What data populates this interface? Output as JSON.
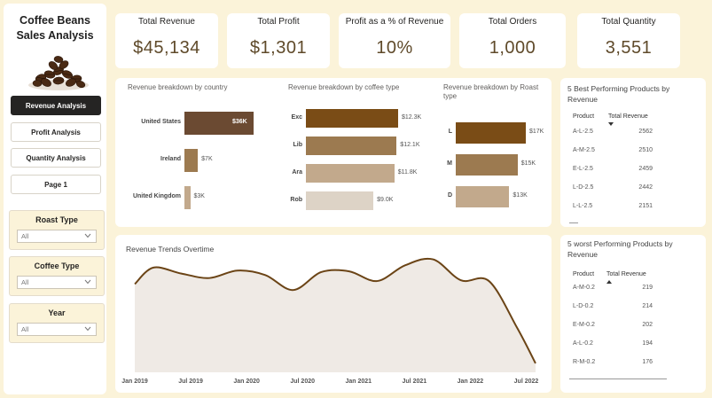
{
  "app": {
    "title_line1": "Coffee Beans",
    "title_line2": "Sales Analysis",
    "image_icon": "coffee-beans-image"
  },
  "nav": [
    {
      "label": "Revenue Analysis",
      "active": true
    },
    {
      "label": "Profit Analysis",
      "active": false
    },
    {
      "label": "Quantity Analysis",
      "active": false
    },
    {
      "label": "Page 1",
      "active": false
    }
  ],
  "filters": [
    {
      "title": "Roast Type",
      "value": "All"
    },
    {
      "title": "Coffee Type",
      "value": "All"
    },
    {
      "title": "Year",
      "value": "All"
    }
  ],
  "kpis": [
    {
      "title": "Total Revenue",
      "value": "$45,134"
    },
    {
      "title": "Total Profit",
      "value": "$1,301"
    },
    {
      "title": "Profit as a % of Revenue",
      "value": "10%"
    },
    {
      "title": "Total Orders",
      "value": "1,000"
    },
    {
      "title": "Total Quantity",
      "value": "3,551"
    }
  ],
  "colors": {
    "dark_brown": "#7a4c16",
    "mid_brown": "#9c7a50",
    "light_brown": "#c2a98c",
    "pale_brown": "#ddd3c6",
    "country_dark": "#6b4a32",
    "line": "#6b4416",
    "area": "#efeae5",
    "page_bg": "#fbf3d9",
    "nav_active": "#252423"
  },
  "chart_data": [
    {
      "type": "bar",
      "orientation": "horizontal",
      "title": "Revenue breakdown by country",
      "categories": [
        "United States",
        "Ireland",
        "United Kingdom"
      ],
      "values": [
        36000,
        7000,
        3000
      ],
      "labels": [
        "$36K",
        "$7K",
        "$3K"
      ]
    },
    {
      "type": "bar",
      "orientation": "horizontal",
      "title": "Revenue breakdown by coffee type",
      "categories": [
        "Exc",
        "Lib",
        "Ara",
        "Rob"
      ],
      "values": [
        12300,
        12100,
        11800,
        9000
      ],
      "labels": [
        "$12.3K",
        "$12.1K",
        "$11.8K",
        "$9.0K"
      ]
    },
    {
      "type": "bar",
      "orientation": "horizontal",
      "title": "Revenue breakdown by Roast type",
      "categories": [
        "L",
        "M",
        "D"
      ],
      "values": [
        17000,
        15000,
        13000
      ],
      "labels": [
        "$17K",
        "$15K",
        "$13K"
      ]
    },
    {
      "type": "area",
      "title": "Revenue Trends Overtime",
      "x_tick_labels": [
        "Jan 2019",
        "Jul 2019",
        "Jan 2020",
        "Jul 2020",
        "Jan 2021",
        "Jul 2021",
        "Jan 2022",
        "Jul 2022"
      ],
      "x": [
        "2019-01",
        "2019-03",
        "2019-06",
        "2019-09",
        "2019-12",
        "2020-03",
        "2020-06",
        "2020-09",
        "2020-12",
        "2021-03",
        "2021-06",
        "2021-09",
        "2021-12",
        "2022-03",
        "2022-06",
        "2022-08"
      ],
      "y": [
        1180,
        1400,
        1320,
        1260,
        1360,
        1300,
        1100,
        1340,
        1350,
        1220,
        1430,
        1510,
        1230,
        1220,
        600,
        120
      ],
      "y_range": [
        0,
        1600
      ]
    }
  ],
  "best_products": {
    "title": "5 Best Performing Products by Revenue",
    "col_product": "Product",
    "col_revenue": "Total Revenue",
    "rows": [
      {
        "product": "A-L-2.5",
        "revenue": "2562"
      },
      {
        "product": "A-M-2.5",
        "revenue": "2510"
      },
      {
        "product": "E-L-2.5",
        "revenue": "2459"
      },
      {
        "product": "L-D-2.5",
        "revenue": "2442"
      },
      {
        "product": "L-L-2.5",
        "revenue": "2151"
      }
    ]
  },
  "worst_products": {
    "title": "5 worst Performing Products by Revenue",
    "col_product": "Product",
    "col_revenue": "Total Revenue",
    "rows": [
      {
        "product": "A-M-0.2",
        "revenue": "219"
      },
      {
        "product": "L-D-0.2",
        "revenue": "214"
      },
      {
        "product": "E-M-0.2",
        "revenue": "202"
      },
      {
        "product": "A-L-0.2",
        "revenue": "194"
      },
      {
        "product": "R-M-0.2",
        "revenue": "176"
      }
    ]
  }
}
